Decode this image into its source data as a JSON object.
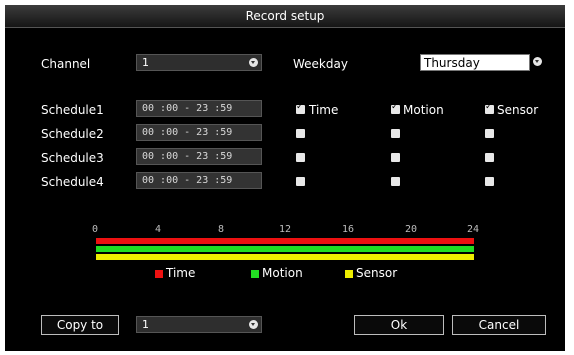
{
  "window": {
    "title": "Record setup"
  },
  "channel": {
    "label": "Channel",
    "value": "1"
  },
  "weekday": {
    "label": "Weekday",
    "value": "Thursday"
  },
  "columns": {
    "time": "Time",
    "motion": "Motion",
    "sensor": "Sensor"
  },
  "schedules": [
    {
      "label": "Schedule1",
      "range": "00 :00 - 23 :59",
      "time": true,
      "motion": true,
      "sensor": true
    },
    {
      "label": "Schedule2",
      "range": "00 :00 - 23 :59",
      "time": false,
      "motion": false,
      "sensor": false
    },
    {
      "label": "Schedule3",
      "range": "00 :00 - 23 :59",
      "time": false,
      "motion": false,
      "sensor": false
    },
    {
      "label": "Schedule4",
      "range": "00 :00 - 23 :59",
      "time": false,
      "motion": false,
      "sensor": false
    }
  ],
  "timeline": {
    "ticks": [
      "0",
      "4",
      "8",
      "12",
      "16",
      "20",
      "24"
    ],
    "colors": {
      "time": "#ee1111",
      "motion": "#22dd22",
      "sensor": "#eeee00"
    }
  },
  "legend": {
    "time": "Time",
    "motion": "Motion",
    "sensor": "Sensor"
  },
  "footer": {
    "copy_label": "Copy to",
    "copy_value": "1",
    "ok_label": "Ok",
    "cancel_label": "Cancel"
  }
}
